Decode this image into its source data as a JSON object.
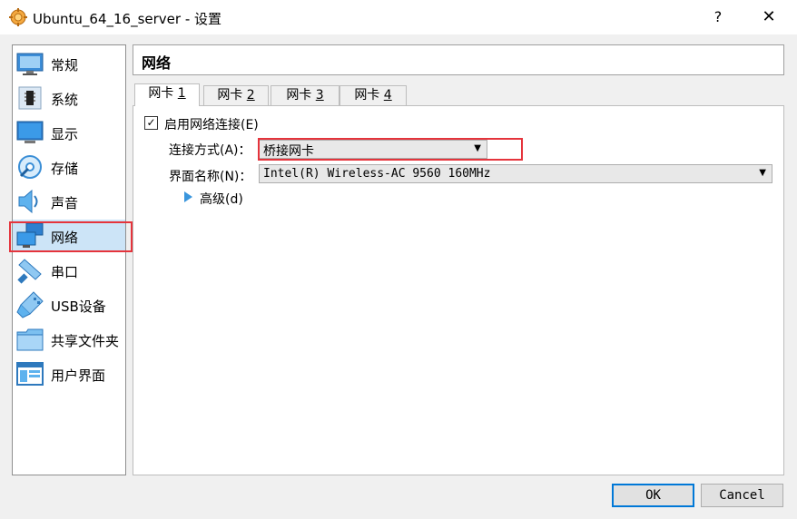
{
  "window": {
    "title": "Ubuntu_64_16_server - 设置",
    "help_label": "?",
    "close_label": "✕"
  },
  "sidebar": {
    "items": [
      {
        "label": "常规",
        "icon": "general-icon"
      },
      {
        "label": "系统",
        "icon": "system-icon"
      },
      {
        "label": "显示",
        "icon": "display-icon"
      },
      {
        "label": "存储",
        "icon": "storage-icon"
      },
      {
        "label": "声音",
        "icon": "audio-icon"
      },
      {
        "label": "网络",
        "icon": "network-icon",
        "selected": true
      },
      {
        "label": "串口",
        "icon": "serial-port-icon"
      },
      {
        "label": "USB设备",
        "icon": "usb-icon"
      },
      {
        "label": "共享文件夹",
        "icon": "shared-folder-icon"
      },
      {
        "label": "用户界面",
        "icon": "user-interface-icon"
      }
    ]
  },
  "page": {
    "title": "网络"
  },
  "tabs": [
    {
      "prefix": "网卡 ",
      "num": "1",
      "active": true
    },
    {
      "prefix": "网卡 ",
      "num": "2"
    },
    {
      "prefix": "网卡 ",
      "num": "3"
    },
    {
      "prefix": "网卡 ",
      "num": "4"
    }
  ],
  "adapter": {
    "enable_checked": true,
    "enable_label": "启用网络连接(E)",
    "attached_label": "连接方式(A)：",
    "attached_value": "桥接网卡",
    "name_label": "界面名称(N)：",
    "name_value": "Intel(R) Wireless-AC 9560 160MHz",
    "advanced_label": "高级(d)"
  },
  "buttons": {
    "ok": "OK",
    "cancel": "Cancel"
  },
  "colors": {
    "highlight_outline": "#e5343c",
    "selection_bg": "#cce4f7",
    "accent": "#0078d7"
  }
}
